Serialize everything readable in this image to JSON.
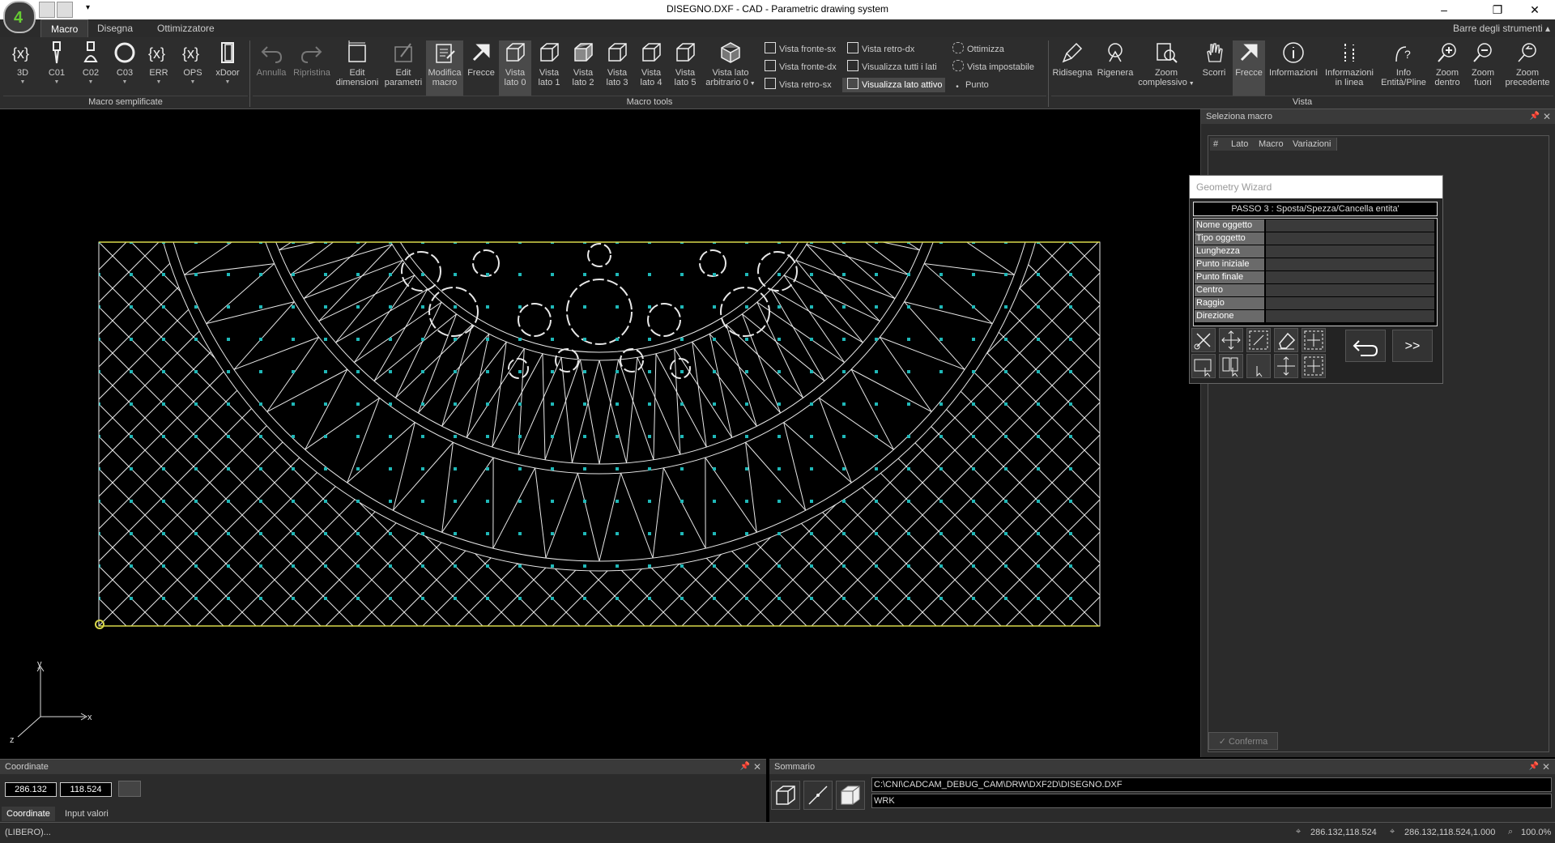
{
  "window": {
    "title": "DISEGNO.DXF - CAD - Parametric drawing system",
    "minimize": "–",
    "restore": "❐",
    "close": "✕",
    "toolbars_label": "Barre degli strumenti"
  },
  "tabs": [
    "Macro",
    "Disegna",
    "Ottimizzatore"
  ],
  "ribbon": {
    "macro_buttons": [
      "3D",
      "C01",
      "C02",
      "C03",
      "ERR",
      "OPS",
      "xDoor"
    ],
    "group1_label": "Macro semplificate",
    "undo": "Annulla",
    "redo": "Ripristina",
    "edit_dimensions": [
      "Edit",
      "dimensioni"
    ],
    "edit_parameters": [
      "Edit",
      "parametri"
    ],
    "modify_macro": [
      "Modifica",
      "macro"
    ],
    "arrows": "Frecce",
    "views": [
      [
        "Vista",
        "lato 0"
      ],
      [
        "Vista",
        "lato 1"
      ],
      [
        "Vista",
        "lato 2"
      ],
      [
        "Vista",
        "lato 3"
      ],
      [
        "Vista",
        "lato 4"
      ],
      [
        "Vista",
        "lato 5"
      ]
    ],
    "view_arbitrary": [
      "Vista lato",
      "arbitrario 0"
    ],
    "small_col1": [
      "Vista fronte-sx",
      "Vista fronte-dx",
      "Vista retro-sx"
    ],
    "small_col2": [
      "Vista retro-dx",
      "Visualizza tutti i lati",
      "Visualizza lato attivo"
    ],
    "small_col3": [
      "Ottimizza",
      "Vista impostabile",
      "Punto"
    ],
    "group2_label": "Macro tools",
    "redraw": "Ridisegna",
    "regen": "Rigenera",
    "zoom_all": [
      "Zoom",
      "complessivo"
    ],
    "pan": "Scorri",
    "arrows2": "Frecce",
    "info": "Informazioni",
    "info_inline": [
      "Informazioni",
      "in linea"
    ],
    "info_entity": [
      "Info",
      "Entità/Pline"
    ],
    "zoom_in": [
      "Zoom",
      "dentro"
    ],
    "zoom_out": [
      "Zoom",
      "fuori"
    ],
    "zoom_prev": [
      "Zoom",
      "precedente"
    ],
    "group3_label": "Vista"
  },
  "axes": {
    "y": "y",
    "x": "x",
    "z": "z"
  },
  "macro_panel": {
    "title": "Seleziona macro",
    "columns": [
      "#",
      "Lato",
      "Macro",
      "Variazioni"
    ],
    "confirm": "Conferma"
  },
  "wizard": {
    "title": "Geometry Wizard",
    "step": "PASSO 3 : Sposta/Spezza/Cancella entita'",
    "props": [
      "Nome oggetto",
      "Tipo oggetto",
      "Lunghezza",
      "Punto iniziale",
      "Punto finale",
      "Centro",
      "Raggio",
      "Direzione"
    ],
    "next": ">>"
  },
  "coord_panel": {
    "title": "Coordinate",
    "x": "286.132",
    "y": "118.524",
    "tabs": [
      "Coordinate",
      "Input valori"
    ]
  },
  "summary_panel": {
    "title": "Sommario",
    "path": "C:\\CNI\\CADCAM_DEBUG_CAM\\DRW\\DXF2D\\DISEGNO.DXF",
    "layer": "WRK"
  },
  "status": {
    "left": "(LIBERO)...",
    "coord2d": "286.132,118.524",
    "coord3d": "286.132,118.524,1.000",
    "zoom": "100.0%"
  }
}
